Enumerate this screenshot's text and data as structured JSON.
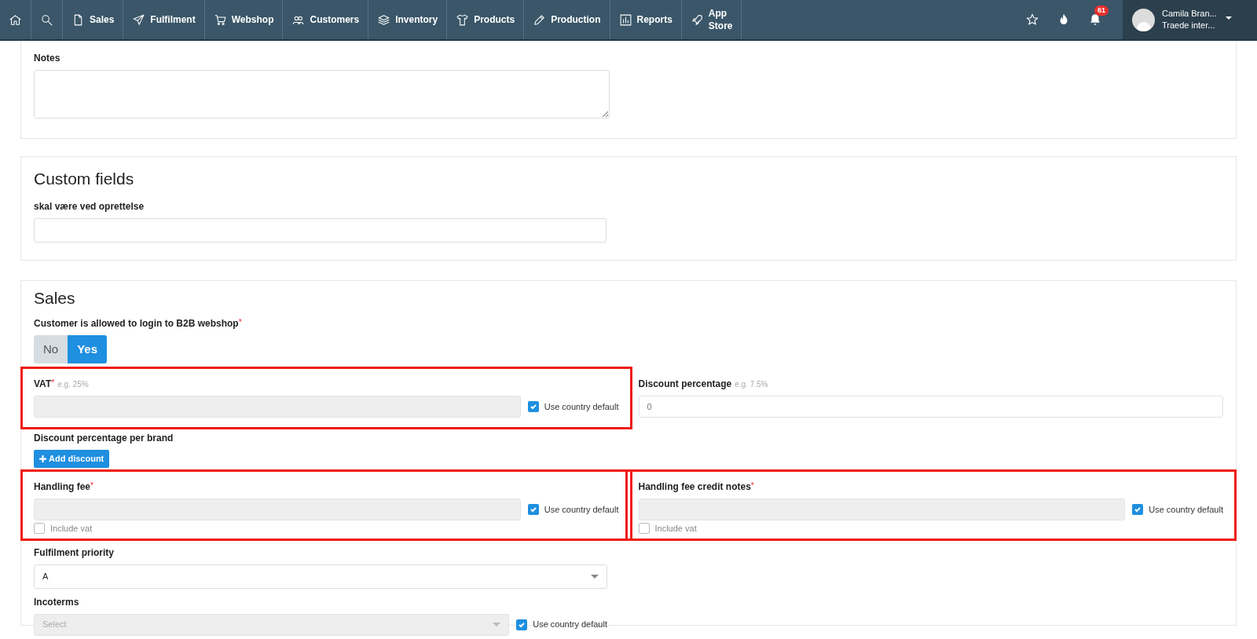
{
  "nav": {
    "items": [
      {
        "kind": "home"
      },
      {
        "kind": "search"
      },
      {
        "kind": "file",
        "label": "Sales"
      },
      {
        "kind": "send",
        "label": "Fulfilment"
      },
      {
        "kind": "cart",
        "label": "Webshop"
      },
      {
        "kind": "users",
        "label": "Customers"
      },
      {
        "kind": "layers",
        "label": "Inventory"
      },
      {
        "kind": "shirt",
        "label": "Products"
      },
      {
        "kind": "pencil",
        "label": "Production"
      },
      {
        "kind": "chart",
        "label": "Reports"
      },
      {
        "kind": "rocket",
        "label": "App Store"
      }
    ],
    "notification_count": "61",
    "user": {
      "name": "Camila Bran...",
      "company": "Traede inter..."
    }
  },
  "notes": {
    "label": "Notes"
  },
  "custom_fields": {
    "title": "Custom fields",
    "fields": [
      {
        "label": "skal være ved oprettelse"
      }
    ]
  },
  "sales": {
    "title": "Sales",
    "b2b_login": {
      "label": "Customer is allowed to login to B2B webshop",
      "required_mark": "*",
      "options": [
        {
          "label": "No",
          "selected": false
        },
        {
          "label": "Yes",
          "selected": true
        }
      ]
    },
    "vat": {
      "label": "VAT",
      "required_mark": "*",
      "hint": "e.g. 25%",
      "highlighted": true,
      "use_default": {
        "label": "Use country default",
        "checked": true
      }
    },
    "discount": {
      "label": "Discount percentage",
      "hint": "e.g. 7.5%",
      "value": "0"
    },
    "discount_per_brand": {
      "label": "Discount percentage per brand",
      "button": "Add discount"
    },
    "handling_fee": {
      "label": "Handling fee",
      "required_mark": "*",
      "highlighted": true,
      "use_default": {
        "label": "Use country default",
        "checked": true
      },
      "include_vat": {
        "label": "Include vat",
        "checked": false
      }
    },
    "handling_fee_credit": {
      "label": "Handling fee credit notes",
      "required_mark": "*",
      "highlighted": true,
      "use_default": {
        "label": "Use country default",
        "checked": true
      },
      "include_vat": {
        "label": "Include vat",
        "checked": false
      }
    },
    "fulfilment_priority": {
      "label": "Fulfilment priority",
      "value": "A"
    },
    "incoterms": {
      "label": "Incoterms",
      "placeholder": "Select",
      "use_default": {
        "label": "Use country default",
        "checked": true
      }
    }
  }
}
